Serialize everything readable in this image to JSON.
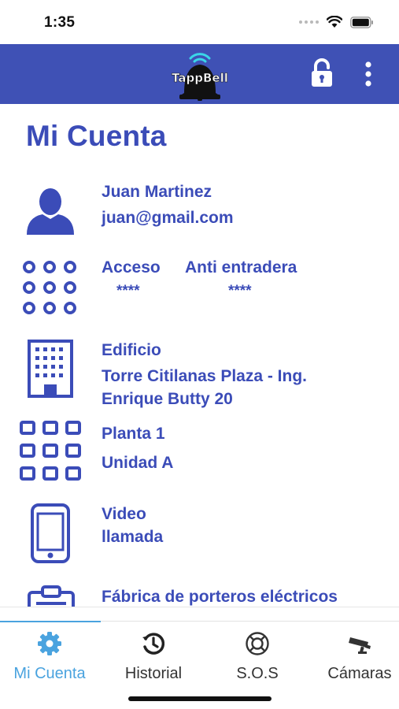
{
  "status_bar": {
    "time": "1:35"
  },
  "header": {
    "logo_text": "TappBell",
    "lock_icon": "lock-open-icon",
    "menu_icon": "more-vertical-icon",
    "color": "#3f51b5"
  },
  "account": {
    "title": "Mi Cuenta",
    "user": {
      "name": "Juan Martinez",
      "email": "juan@gmail.com"
    },
    "access": {
      "label": "Acceso",
      "value": "****",
      "anti_label": "Anti entradera",
      "anti_value": "****"
    },
    "building": {
      "label": "Edificio",
      "address_line1": "Torre Citilanas Plaza - Ing.",
      "address_line2": "Enrique Butty 20"
    },
    "unit": {
      "floor": "Planta 1",
      "unit": "Unidad A"
    },
    "video": {
      "line1": "Video",
      "line2": "llamada"
    },
    "factory": {
      "label": "Fábrica de porteros eléctricos"
    }
  },
  "tabs": [
    {
      "label": "Mi Cuenta",
      "icon": "gear-icon",
      "active": true
    },
    {
      "label": "Historial",
      "icon": "history-icon",
      "active": false
    },
    {
      "label": "S.O.S",
      "icon": "lifebuoy-icon",
      "active": false
    },
    {
      "label": "Cámaras",
      "icon": "camera-icon",
      "active": false
    }
  ],
  "colors": {
    "primary": "#3f51b5",
    "text": "#3b4cb8",
    "tab_active": "#4aa3df"
  }
}
